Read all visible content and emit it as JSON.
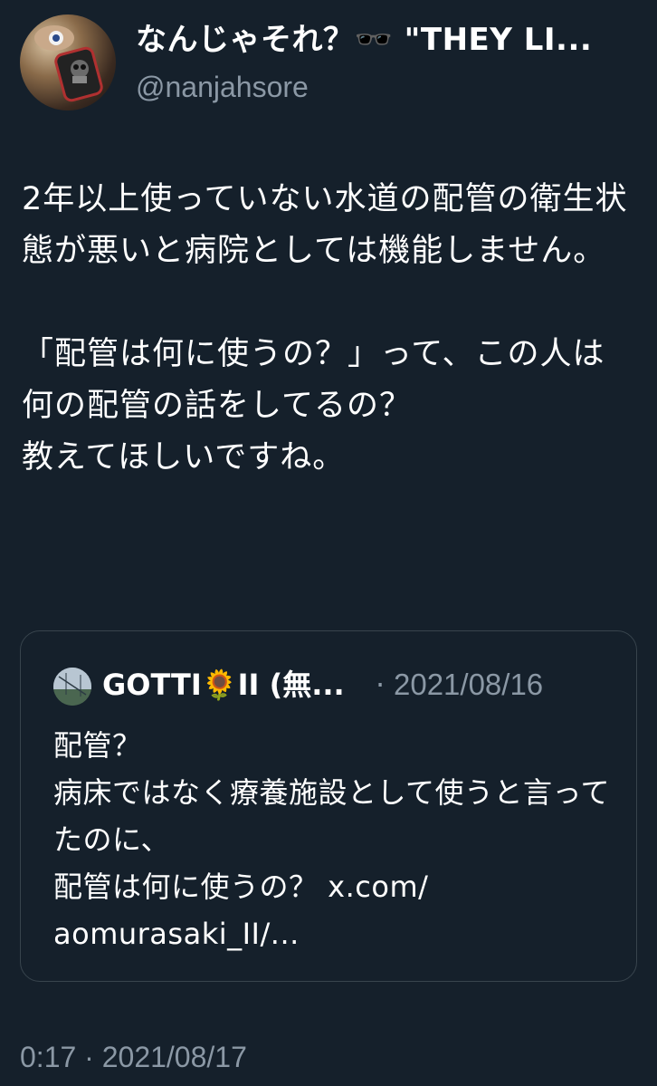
{
  "theme": {
    "background": "#15202b",
    "text_primary": "#ffffff",
    "text_secondary": "#8b98a5",
    "border": "#38444d"
  },
  "author": {
    "display_name": "なんじゃそれ？🕶️ \"THEY LI...",
    "handle": "@nanjahsore",
    "avatar": "user-avatar-image"
  },
  "tweet": {
    "text": "2年以上使っていない水道の配管の衛生状態が悪いと病院としては機能しません。\n\n「配管は何に使うの？」って、この人は何の配管の話をしてるの？\n教えてほしいですね。",
    "time": "0:17",
    "separator": "·",
    "date": "2021/08/17"
  },
  "quoted_tweet": {
    "author_name": "GOTTI🌻II (無...",
    "separator": "·",
    "date": "2021/08/16",
    "avatar": "quoted-user-avatar-image",
    "text": "配管？\n病床ではなく療養施設として使うと言ってたのに、\n配管は何に使うの？ x.com/\naomurasaki_II/..."
  }
}
